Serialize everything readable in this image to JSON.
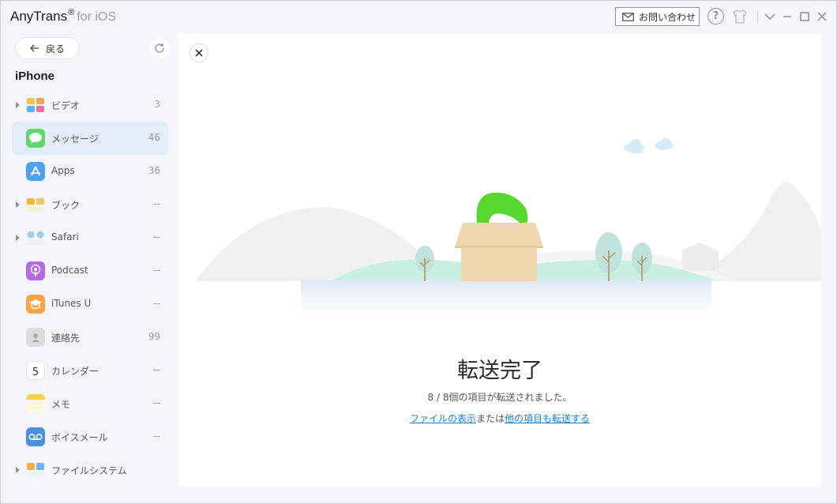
{
  "app": {
    "name": "AnyTrans",
    "reg_mark": "®",
    "suffix": "for iOS",
    "contact_label": "お問い合わせ",
    "help_glyph": "?"
  },
  "sidebar": {
    "back_label": "戻る",
    "device_name": "iPhone",
    "items": [
      {
        "label": "ビデオ",
        "count": "3",
        "expandable": true,
        "icon": "video-icon"
      },
      {
        "label": "メッセージ",
        "count": "46",
        "expandable": false,
        "active": true,
        "icon": "messages-icon"
      },
      {
        "label": "Apps",
        "count": "36",
        "expandable": false,
        "icon": "app-store-icon"
      },
      {
        "label": "ブック",
        "count": "--",
        "expandable": true,
        "icon": "books-icon"
      },
      {
        "label": "Safari",
        "count": "--",
        "expandable": true,
        "icon": "safari-icon"
      },
      {
        "label": "Podcast",
        "count": "--",
        "expandable": false,
        "icon": "podcast-icon"
      },
      {
        "label": "iTunes U",
        "count": "--",
        "expandable": false,
        "icon": "itunes-u-icon"
      },
      {
        "label": "連絡先",
        "count": "99",
        "expandable": false,
        "icon": "contacts-icon"
      },
      {
        "label": "カレンダー",
        "count": "--",
        "expandable": false,
        "icon": "calendar-icon",
        "icon_text": "5"
      },
      {
        "label": "メモ",
        "count": "--",
        "expandable": false,
        "icon": "notes-icon"
      },
      {
        "label": "ボイスメール",
        "count": "--",
        "expandable": false,
        "icon": "voicemail-icon"
      },
      {
        "label": "ファイルシステム",
        "count": "",
        "expandable": true,
        "icon": "file-system-icon"
      }
    ]
  },
  "main": {
    "title": "転送完了",
    "subtitle": "8 / 8個の項目が転送されました。",
    "link_view_files": "ファイルの表示",
    "link_separator": "または",
    "link_transfer_more": "他の項目も転送する"
  },
  "colors": {
    "accent_link": "#1a7fd0",
    "active_item_bg": "#e3edf7",
    "grass_green": "#58d82e"
  }
}
